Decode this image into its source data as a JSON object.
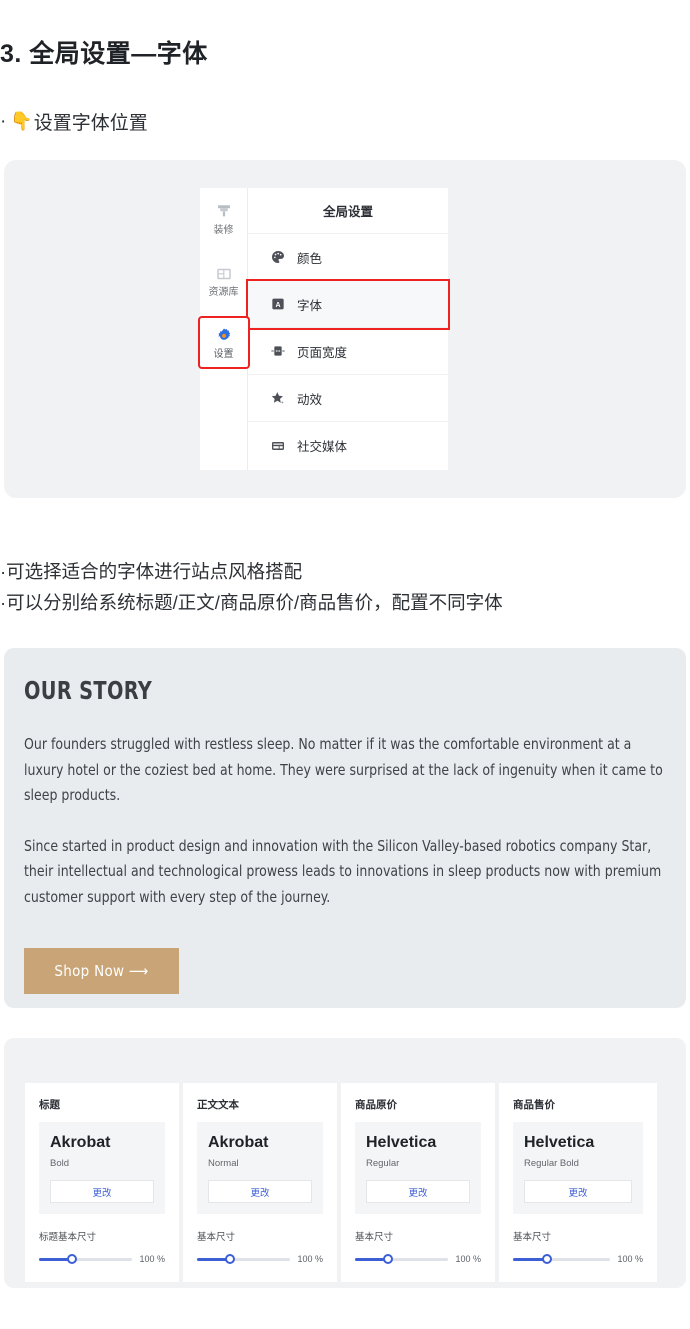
{
  "doc": {
    "title": "3. 全局设置—字体",
    "subtitle_bullet": "·",
    "subtitle_icon": "pointing-down-hand-icon",
    "subtitle": "设置字体位置",
    "bullets": [
      "·可选择适合的字体进行站点风格搭配",
      "·可以分别给系统标题/正文/商品原价/商品售价，配置不同字体"
    ]
  },
  "panel": {
    "rail": [
      {
        "label": "装修",
        "icon": "paint-brush-icon",
        "active": false,
        "highlight": false
      },
      {
        "label": "资源库",
        "icon": "library-grid-icon",
        "active": false,
        "highlight": false
      },
      {
        "label": "设置",
        "icon": "gear-icon",
        "active": true,
        "highlight": true
      }
    ],
    "header": "全局设置",
    "items": [
      {
        "label": "颜色",
        "icon": "palette-icon",
        "selected": false
      },
      {
        "label": "字体",
        "icon": "font-letter-a-icon",
        "selected": true
      },
      {
        "label": "页面宽度",
        "icon": "page-width-icon",
        "selected": false
      },
      {
        "label": "动效",
        "icon": "star-sparkle-icon",
        "selected": false
      },
      {
        "label": "社交媒体",
        "icon": "social-media-card-icon",
        "selected": false
      }
    ],
    "highlight_color": "#ef2222",
    "accent_color": "#3c5fd6"
  },
  "story": {
    "heading": "OUR STORY",
    "paragraphs": [
      "Our founders struggled with restless sleep. No matter if it was the comfortable environment at a luxury hotel or the coziest bed at home. They were surprised at the lack of ingenuity when it came to sleep products.",
      "Since started in product design and innovation with the Silicon Valley-based robotics company Star, their intellectual and technological prowess leads to innovations in sleep products now with premium customer support with every step of the journey."
    ],
    "button_label": "Shop Now ⟶",
    "button_color": "#c8a476",
    "background_color": "#e9ecef"
  },
  "font_cards": [
    {
      "title": "标题",
      "font_name": "Akrobat",
      "weight": "Bold",
      "change_label": "更改",
      "size_label": "标题基本尺寸",
      "size_value": "100 %",
      "slider_percent": 35
    },
    {
      "title": "正文文本",
      "font_name": "Akrobat",
      "weight": "Normal",
      "change_label": "更改",
      "size_label": "基本尺寸",
      "size_value": "100 %",
      "slider_percent": 35
    },
    {
      "title": "商品原价",
      "font_name": "Helvetica",
      "weight": "Regular",
      "change_label": "更改",
      "size_label": "基本尺寸",
      "size_value": "100 %",
      "slider_percent": 35
    },
    {
      "title": "商品售价",
      "font_name": "Helvetica",
      "weight": "Regular Bold",
      "change_label": "更改",
      "size_label": "基本尺寸",
      "size_value": "100 %",
      "slider_percent": 35
    }
  ]
}
